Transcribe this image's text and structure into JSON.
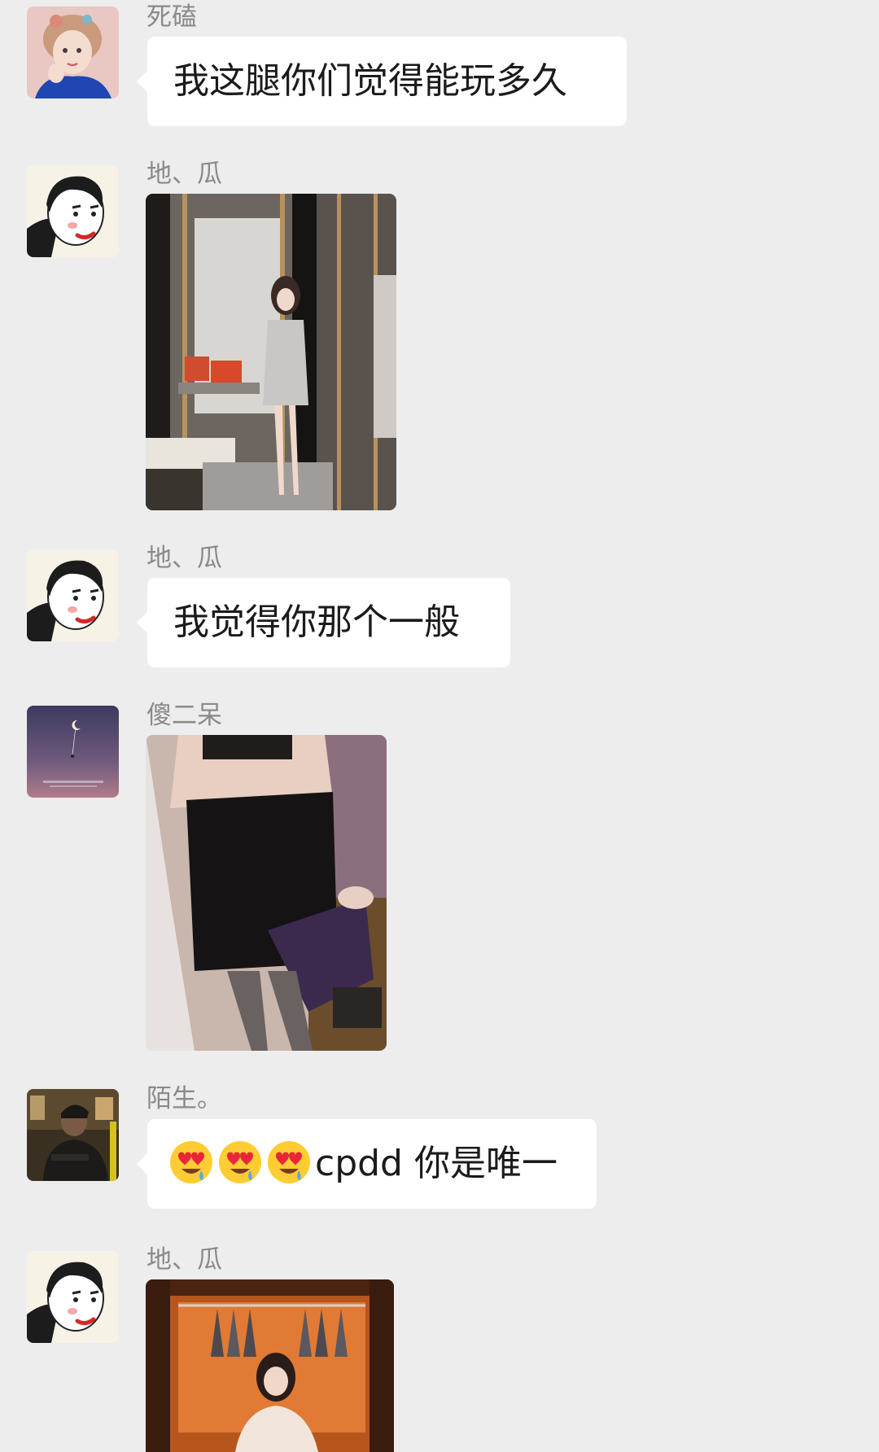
{
  "messages": [
    {
      "sender": "死磕",
      "type": "text",
      "text": "我这腿你们觉得能玩多久",
      "avatar_icon": "girl-portrait-avatar"
    },
    {
      "sender": "地、瓜",
      "type": "image",
      "image_icon": "photo-dressing-room",
      "avatar_icon": "cartoon-face-avatar"
    },
    {
      "sender": "地、瓜",
      "type": "text",
      "text": "我觉得你那个一般",
      "avatar_icon": "cartoon-face-avatar"
    },
    {
      "sender": "傻二呆",
      "type": "image",
      "image_icon": "photo-black-dress",
      "avatar_icon": "night-sky-avatar"
    },
    {
      "sender": "陌生。",
      "type": "text",
      "emoji": "heart-eyes-face-icon",
      "emoji_count": 3,
      "text": "cpdd 你是唯一",
      "avatar_icon": "bus-passenger-avatar"
    },
    {
      "sender": "地、瓜",
      "type": "image",
      "image_icon": "photo-wardrobe",
      "avatar_icon": "cartoon-face-avatar"
    }
  ],
  "colors": {
    "background": "#ededed",
    "bubble": "#ffffff",
    "name_text": "#8a8a8a",
    "message_text": "#1b1b1b"
  }
}
